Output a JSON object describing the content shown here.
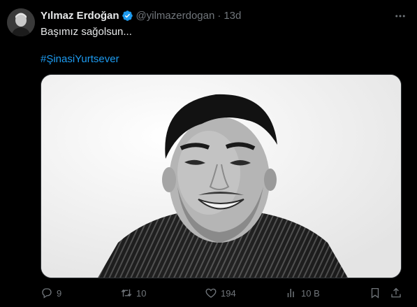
{
  "tweet": {
    "author_name": "Yılmaz Erdoğan",
    "handle": "@yilmazerdogan",
    "separator": "·",
    "time": "13d",
    "text": "Başımız sağolsun...",
    "hashtag": "#ŞinasiYurtsever"
  },
  "actions": {
    "replies": "9",
    "retweets": "10",
    "likes": "194",
    "views": "10 B"
  },
  "icons": {
    "verified": "verified-badge-icon",
    "more": "more-options-icon",
    "reply": "reply-icon",
    "retweet": "retweet-icon",
    "like": "heart-icon",
    "views": "analytics-icon",
    "bookmark": "bookmark-icon",
    "share": "share-icon"
  },
  "colors": {
    "background": "#000000",
    "text": "#e7e9ea",
    "muted": "#71767b",
    "link": "#1d9bf0",
    "verified": "#1d9bf0"
  }
}
